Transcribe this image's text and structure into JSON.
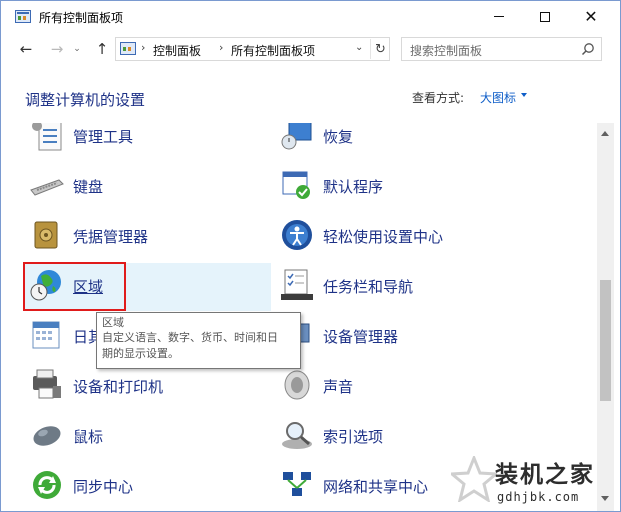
{
  "window": {
    "title": "所有控制面板项",
    "minimize_glyph": "—",
    "maximize_glyph": "☐",
    "close_glyph": "✕"
  },
  "nav": {
    "back_glyph": "←",
    "forward_glyph": "→",
    "history_glyph": "⌄",
    "up_glyph": "↑",
    "breadcrumb": [
      "控制面板",
      "所有控制面板项"
    ],
    "breadcrumb_sep": "›",
    "dropdown_glyph": "⌄",
    "refresh_glyph": "↻",
    "search_placeholder": "搜索控制面板"
  },
  "header": {
    "title": "调整计算机的设置",
    "view_label": "查看方式:",
    "view_value": "大图标"
  },
  "items": {
    "left": [
      "管理工具",
      "键盘",
      "凭据管理器",
      "区域",
      "日期和时间",
      "设备和打印机",
      "鼠标",
      "同步中心"
    ],
    "right": [
      "恢复",
      "默认程序",
      "轻松使用设置中心",
      "任务栏和导航",
      "设备管理器",
      "声音",
      "索引选项",
      "网络和共享中心"
    ]
  },
  "tooltip": {
    "title": "区域",
    "line1": "自定义语言、数字、货币、时间和日",
    "line2": "期的显示设置。"
  },
  "left_partial_label": "日其",
  "watermark": {
    "title": "装机之家",
    "url": "gdhjbk.com"
  },
  "colors": {
    "link": "#1e3287",
    "accent": "#0f5ec8",
    "highlight": "#e5f3fb",
    "annotation": "#e01b1b"
  }
}
